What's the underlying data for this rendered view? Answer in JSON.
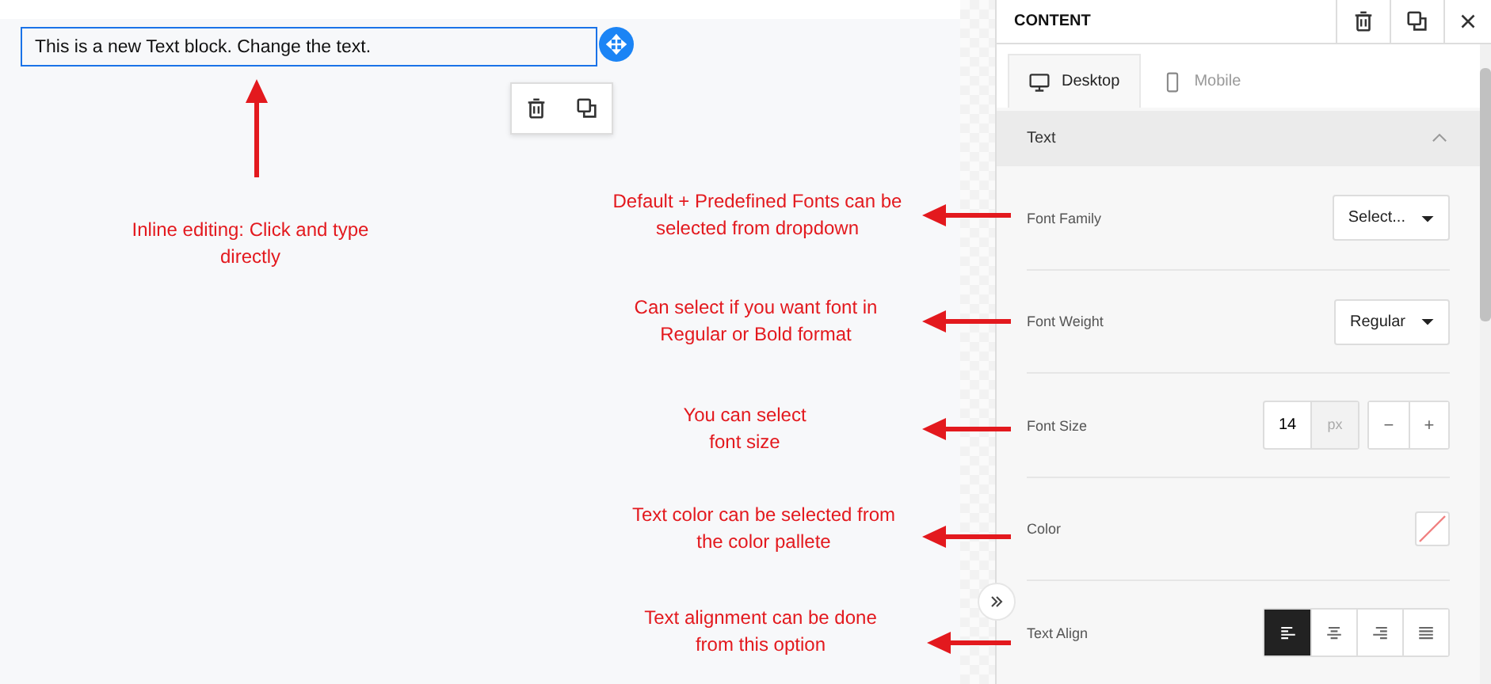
{
  "canvas": {
    "text_block": {
      "text": "This is a new Text block. Change the text.",
      "selected": true
    }
  },
  "panel": {
    "title": "CONTENT",
    "tabs": [
      {
        "label": "Desktop",
        "kind": "desktop",
        "selected": true
      },
      {
        "label": "Mobile",
        "kind": "mobile",
        "selected": false
      }
    ],
    "section": {
      "title": "Text",
      "expanded": true
    },
    "rows": [
      {
        "label": "Font Family",
        "kind": "dropdown",
        "value": "Select..."
      },
      {
        "label": "Font Weight",
        "kind": "dropdown",
        "value": "Regular"
      },
      {
        "label": "Font Size",
        "kind": "number",
        "value": "14",
        "unit": "px",
        "minus": "−",
        "plus": "+"
      },
      {
        "label": "Color",
        "kind": "color"
      },
      {
        "label": "Text Align",
        "kind": "align",
        "options": [
          {
            "kind": "left",
            "selected": true
          },
          {
            "kind": "center",
            "selected": false
          },
          {
            "kind": "right",
            "selected": false
          },
          {
            "kind": "justify",
            "selected": false
          }
        ]
      }
    ]
  },
  "annotations": [
    {
      "text": "Inline editing: Click and type directly",
      "kind": "arrow-up"
    },
    {
      "text": "Default + Predefined Fonts can be selected from dropdown",
      "kind": "arrow-left"
    },
    {
      "text": "Can select if you want font in Regular or Bold format",
      "kind": "arrow-left"
    },
    {
      "text": "You can select font size",
      "kind": "arrow-left"
    },
    {
      "text": "Text color can be selected from the color pallete",
      "kind": "arrow-left"
    },
    {
      "text": "Text alignment can be done from this option",
      "kind": "arrow-left"
    }
  ]
}
